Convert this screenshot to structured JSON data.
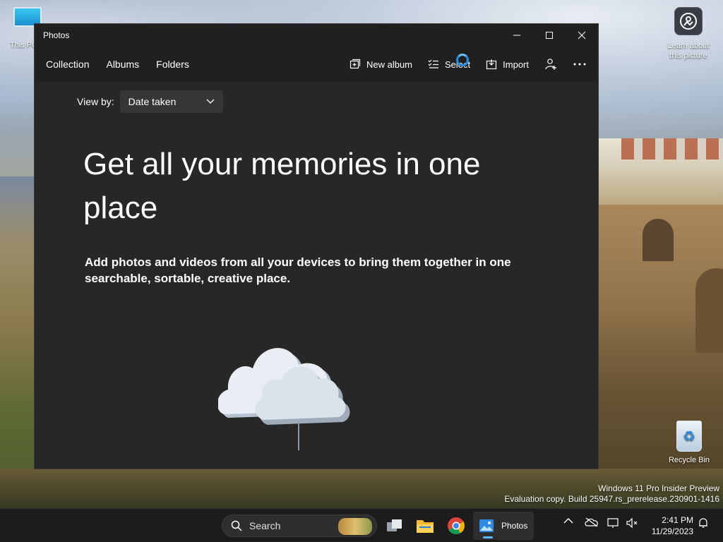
{
  "desktop": {
    "icons": [
      {
        "label": "This PC"
      },
      {
        "label": "Learn about this picture"
      },
      {
        "label": "Recycle Bin"
      }
    ],
    "watermark": {
      "line1": "Windows 11 Pro Insider Preview",
      "line2": "Evaluation copy. Build 25947.rs_prerelease.230901-1416"
    }
  },
  "window": {
    "title": "Photos",
    "nav": [
      "Collection",
      "Albums",
      "Folders"
    ],
    "toolbar": {
      "new_album": "New album",
      "select": "Select",
      "import": "Import"
    },
    "view_by": {
      "label": "View by:",
      "selected": "Date taken"
    },
    "headline": "Get all your memories in one place",
    "subtext": "Add photos and videos from all your devices to bring them together in one searchable, sortable, creative place."
  },
  "taskbar": {
    "search_label": "Search",
    "active_app": "Photos",
    "time": "2:41 PM",
    "date": "11/29/2023"
  },
  "colors": {
    "window_bg": "#202020",
    "content_bg": "#272727",
    "accent": "#1f8fe8",
    "taskbar_bg": "#1c1c1c"
  }
}
